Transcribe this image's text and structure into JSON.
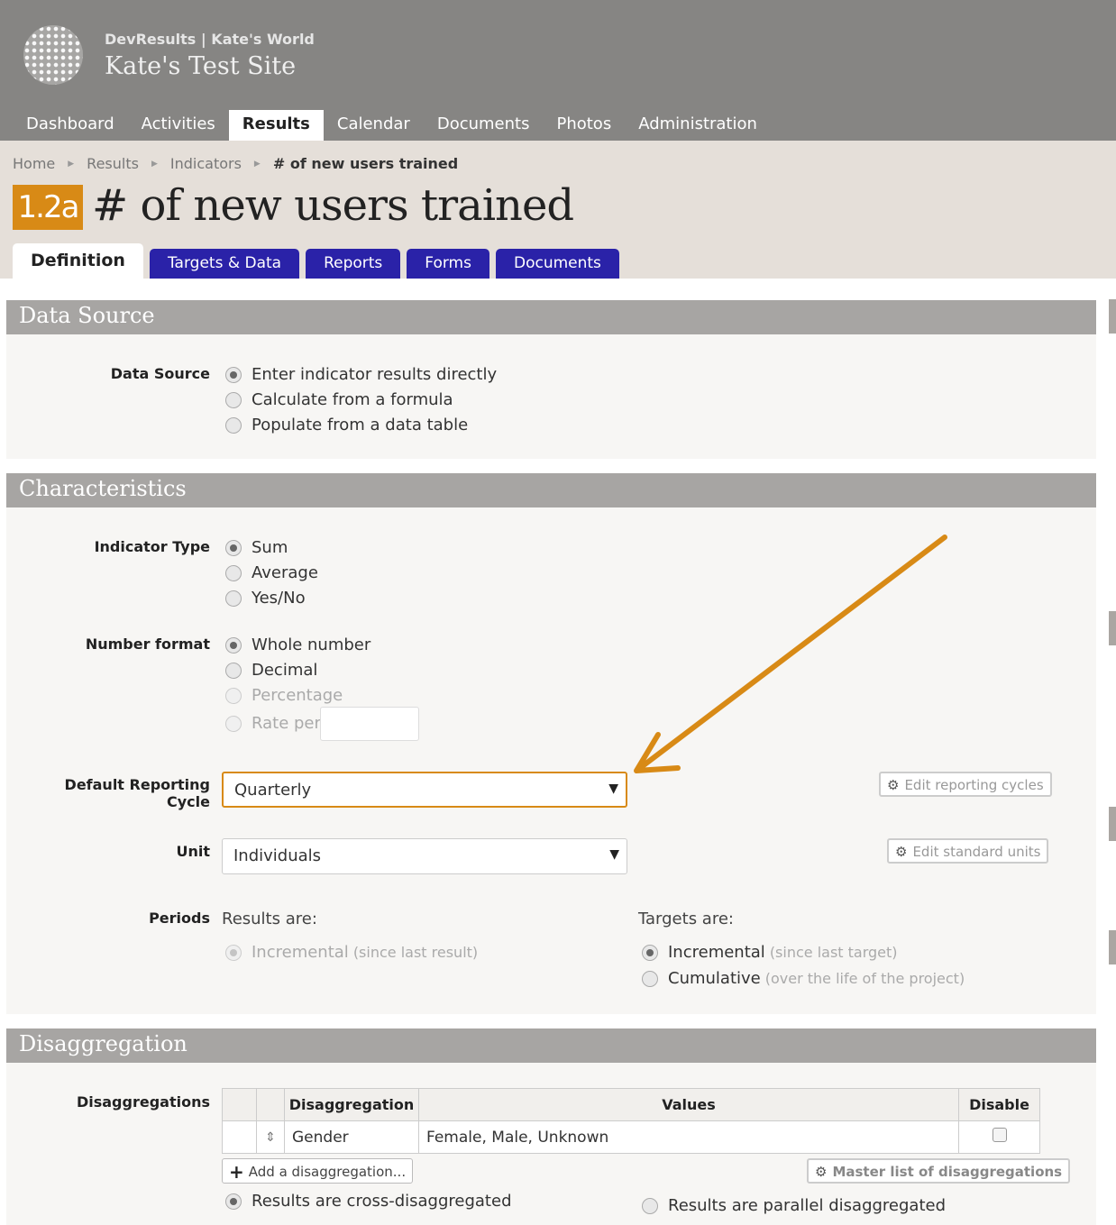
{
  "header": {
    "org": "DevResults | Kate's World",
    "site": "Kate's Test Site",
    "nav": [
      "Dashboard",
      "Activities",
      "Results",
      "Calendar",
      "Documents",
      "Photos",
      "Administration"
    ],
    "active_nav": "Results"
  },
  "breadcrumb": [
    "Home",
    "Results",
    "Indicators",
    "# of new users trained"
  ],
  "indicator": {
    "code": "1.2a",
    "title": "# of new users trained"
  },
  "tabs": [
    "Definition",
    "Targets & Data",
    "Reports",
    "Forms",
    "Documents"
  ],
  "data_source": {
    "heading": "Data Source",
    "label": "Data Source",
    "options": [
      "Enter indicator results directly",
      "Calculate from a formula",
      "Populate from a data table"
    ],
    "selected": "Enter indicator results directly"
  },
  "characteristics": {
    "heading": "Characteristics",
    "indicator_type": {
      "label": "Indicator Type",
      "options": [
        "Sum",
        "Average",
        "Yes/No"
      ],
      "selected": "Sum"
    },
    "number_format": {
      "label": "Number format",
      "options": [
        "Whole number",
        "Decimal",
        "Percentage",
        "Rate per"
      ],
      "selected": "Whole number"
    },
    "reporting_cycle": {
      "label": "Default Reporting Cycle",
      "value": "Quarterly",
      "edit": "Edit reporting cycles"
    },
    "unit": {
      "label": "Unit",
      "value": "Individuals",
      "edit": "Edit standard units"
    },
    "periods": {
      "label": "Periods",
      "results_heading": "Results are:",
      "results_option": "Incremental",
      "results_hint": "(since last result)",
      "targets_heading": "Targets are:",
      "targets_options": [
        {
          "text": "Incremental",
          "hint": "(since last target)"
        },
        {
          "text": "Cumulative",
          "hint": "(over the life of the project)"
        }
      ],
      "targets_selected": "Incremental"
    }
  },
  "disaggregation": {
    "heading": "Disaggregation",
    "label": "Disaggregations",
    "columns": [
      "Disaggregation",
      "Values",
      "Disable"
    ],
    "rows": [
      {
        "name": "Gender",
        "values": "Female, Male, Unknown",
        "disabled": false
      }
    ],
    "add": "Add a disaggregation...",
    "master": "Master list of disaggregations",
    "cross": "Results are cross-disaggregated",
    "parallel": "Results are parallel disaggregated",
    "selected": "Results are cross-disaggregated"
  },
  "colors": {
    "accent": "#d88a16",
    "tab": "#2a22a8",
    "header": "#868583",
    "band": "#e5dfd9"
  }
}
